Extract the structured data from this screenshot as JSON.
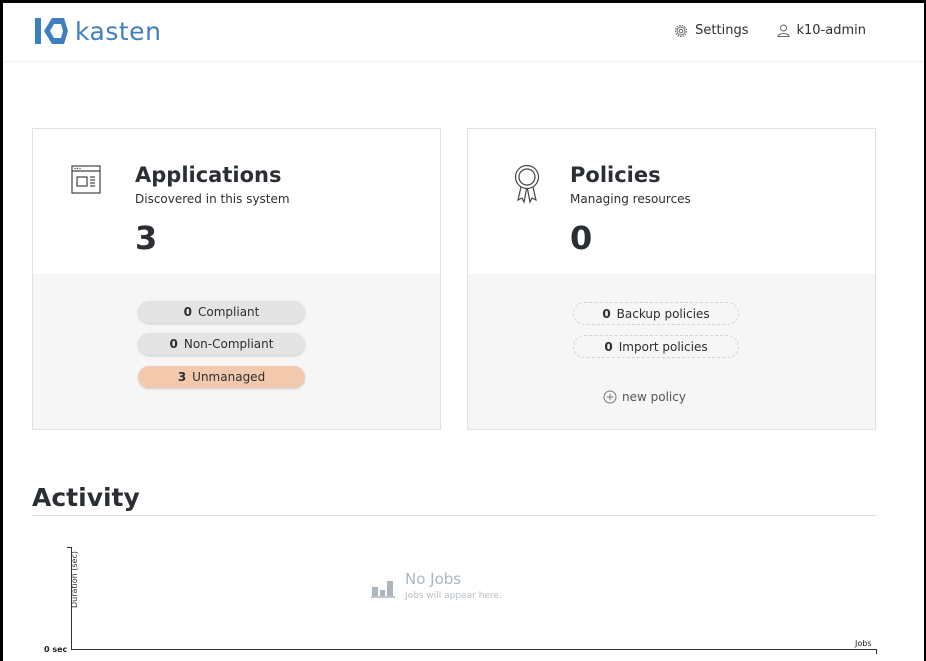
{
  "header": {
    "brand": "kasten",
    "settings_label": "Settings",
    "user_label": "k10-admin",
    "brand_color": "#3e7fc0"
  },
  "applications": {
    "title": "Applications",
    "subtitle": "Discovered in this system",
    "count": "3",
    "statuses": [
      {
        "count": "0",
        "label": "Compliant"
      },
      {
        "count": "0",
        "label": "Non-Compliant"
      },
      {
        "count": "3",
        "label": "Unmanaged",
        "color": "#f3c9ae"
      }
    ]
  },
  "policies": {
    "title": "Policies",
    "subtitle": "Managing resources",
    "count": "0",
    "items": [
      {
        "count": "0",
        "label": "Backup policies"
      },
      {
        "count": "0",
        "label": "Import policies"
      }
    ],
    "new_policy_label": "new policy"
  },
  "activity": {
    "title": "Activity",
    "chart": {
      "y_label": "Duration (sec)",
      "y_zero": "0 sec",
      "x_label": "Jobs",
      "empty_title": "No Jobs",
      "empty_subtitle": "Jobs will appear here."
    }
  }
}
